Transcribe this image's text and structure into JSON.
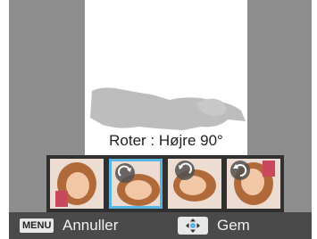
{
  "status": {
    "text": "Roter : Højre 90°"
  },
  "thumbnails": [
    {
      "name": "original",
      "selected": false,
      "icon": "none"
    },
    {
      "name": "rotate-right",
      "selected": true,
      "icon": "rotate-clockwise-icon"
    },
    {
      "name": "rotate-left",
      "selected": false,
      "icon": "rotate-counterclockwise-icon"
    },
    {
      "name": "rotate-180",
      "selected": false,
      "icon": "rotate-180-icon"
    }
  ],
  "bottombar": {
    "menu_key": "MENU",
    "cancel_label": "Annuller",
    "pad_icon": "dpad-ok-icon",
    "save_label": "Gem"
  },
  "colors": {
    "selection": "#5ab4e4",
    "bar": "#4a4a4a",
    "dim": "#8e8e8e"
  }
}
